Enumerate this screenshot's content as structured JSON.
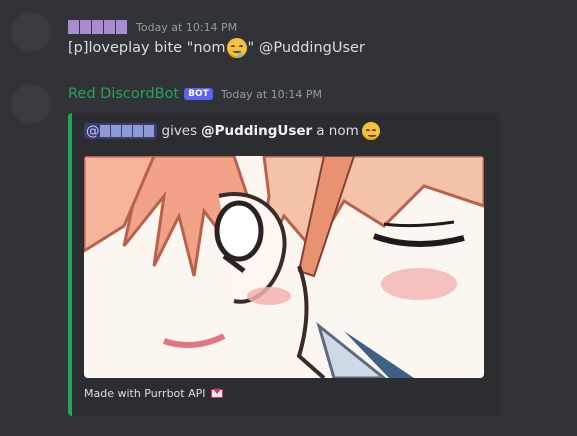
{
  "messages": [
    {
      "user_censored_blocks": 5,
      "timestamp": "Today at 10:14 PM",
      "content_prefix": "[p]loveplay bite \"nom",
      "emoji": "drooling-face",
      "content_suffix": "\" @PuddingUser"
    },
    {
      "username": "Red DiscordBot",
      "bot_badge": "BOT",
      "timestamp": "Today at 10:14 PM",
      "embed": {
        "mention_prefix": "@",
        "mention_censored_blocks": 5,
        "desc_verb": "gives",
        "desc_target": "@PuddingUser",
        "desc_suffix": "a nom",
        "desc_emoji": "smiling-blushing-face",
        "image_alt": "anime bite gif",
        "footer_text": "Made with Purrbot API",
        "footer_icon": "love-letter-icon"
      }
    }
  ],
  "colors": {
    "background": "#313338",
    "bot_name": "#23a55a",
    "embed_accent": "#23a55a",
    "bot_badge": "#5865f2",
    "censor": "#a88bd0"
  }
}
